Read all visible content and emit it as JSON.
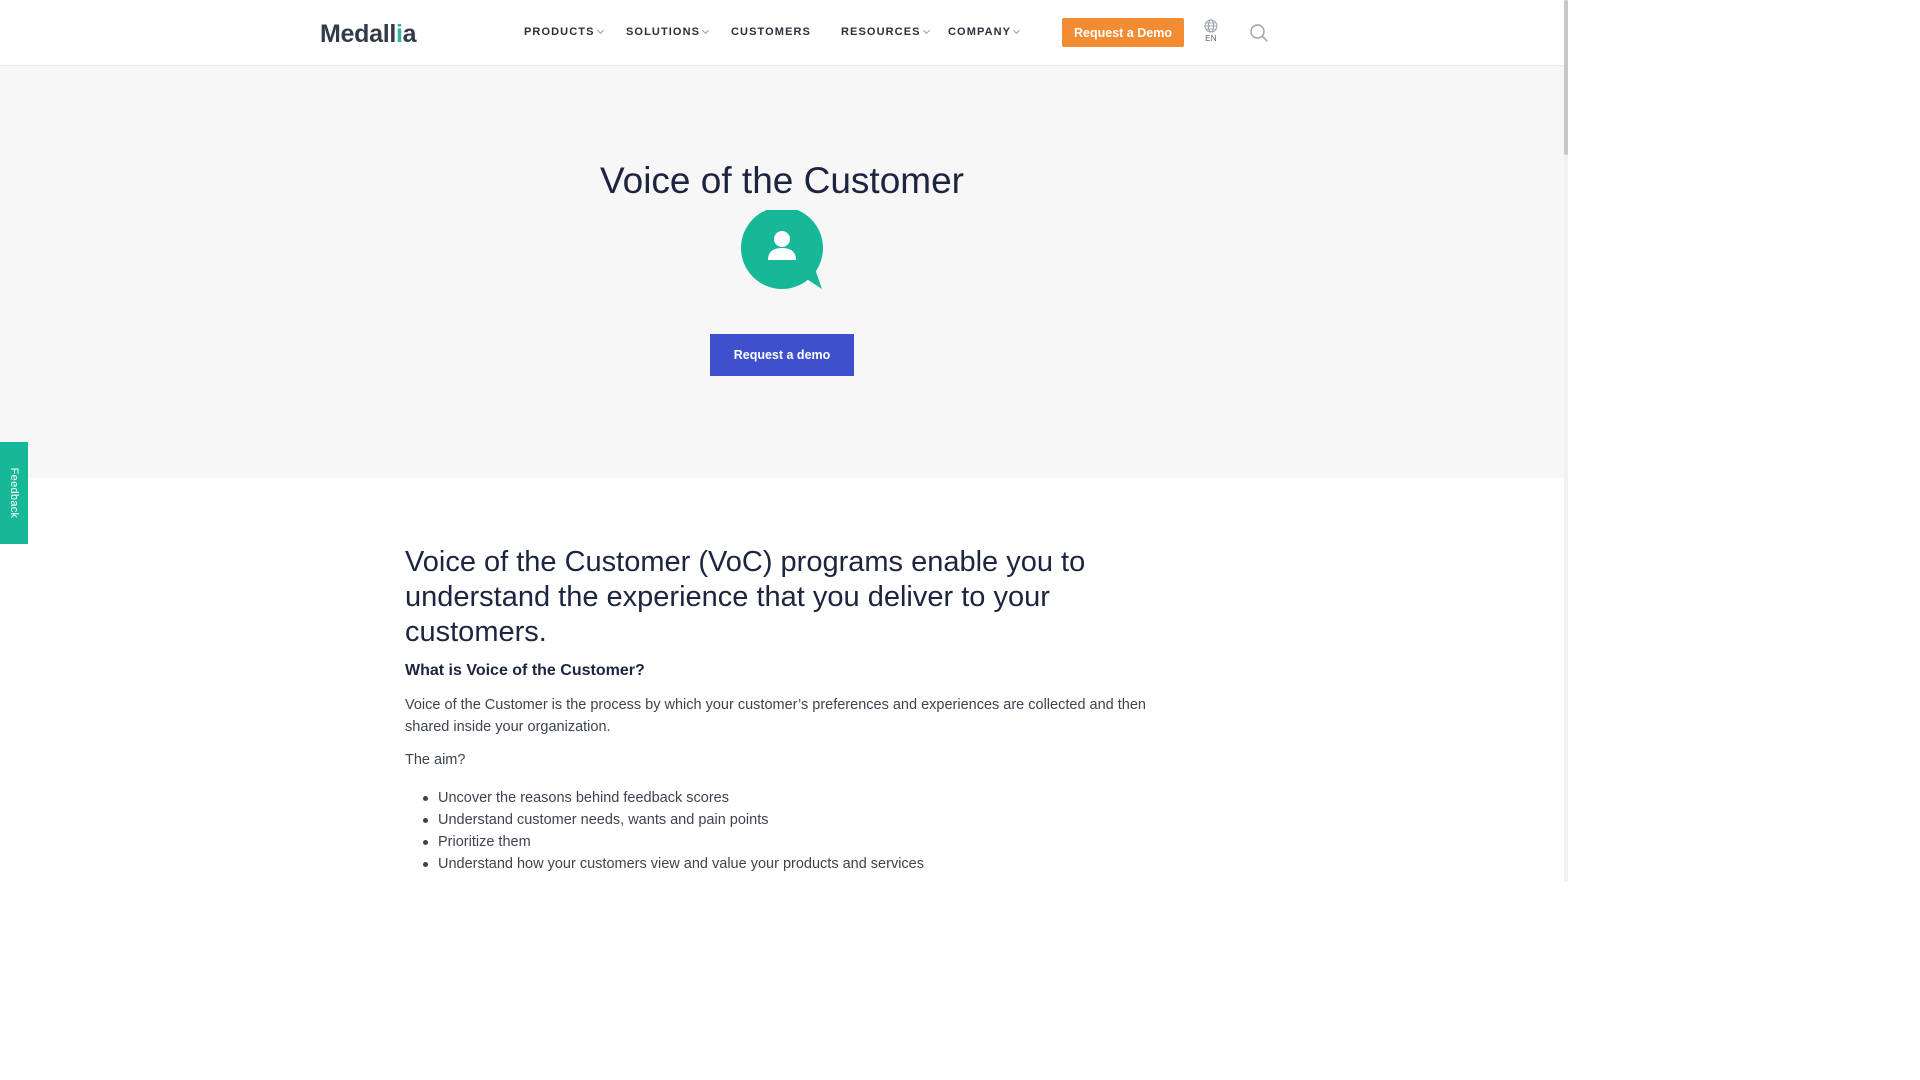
{
  "brand": {
    "logo_text_start": "Medall",
    "logo_text_i": "i",
    "logo_text_end": "a"
  },
  "nav": {
    "products": "PRODUCTS",
    "solutions": "SOLUTIONS",
    "customers": "CUSTOMERS",
    "resources": "RESOURCES",
    "company": "COMPANY",
    "demo_button": "Request a Demo",
    "language": "EN",
    "globe_icon": "globe-icon",
    "search_icon": "search-icon"
  },
  "hero": {
    "title": "Voice of the Customer",
    "icon": "person-speech-bubble-icon",
    "button": "Request a demo"
  },
  "feedback_tab": "Feedback",
  "content": {
    "lead": "Voice of the Customer (VoC) programs enable you to understand the experience that you deliver to your customers.",
    "heading": "What is Voice of the Customer?",
    "paragraph": "Voice of the Customer is the process by which your customer’s preferences and experiences are collected and then shared inside your organization.",
    "aim": "The aim?",
    "bullets": [
      "Uncover the reasons behind feedback scores",
      "Understand customer needs, wants and pain points",
      "Prioritize them",
      "Understand how your customers view and value your products and services"
    ]
  },
  "colors": {
    "accent_orange": "#f28c33",
    "primary_blue": "#3e50cc",
    "teal": "#17b898",
    "text_dark": "#1c2440",
    "hero_bg": "#f7f7f7"
  }
}
